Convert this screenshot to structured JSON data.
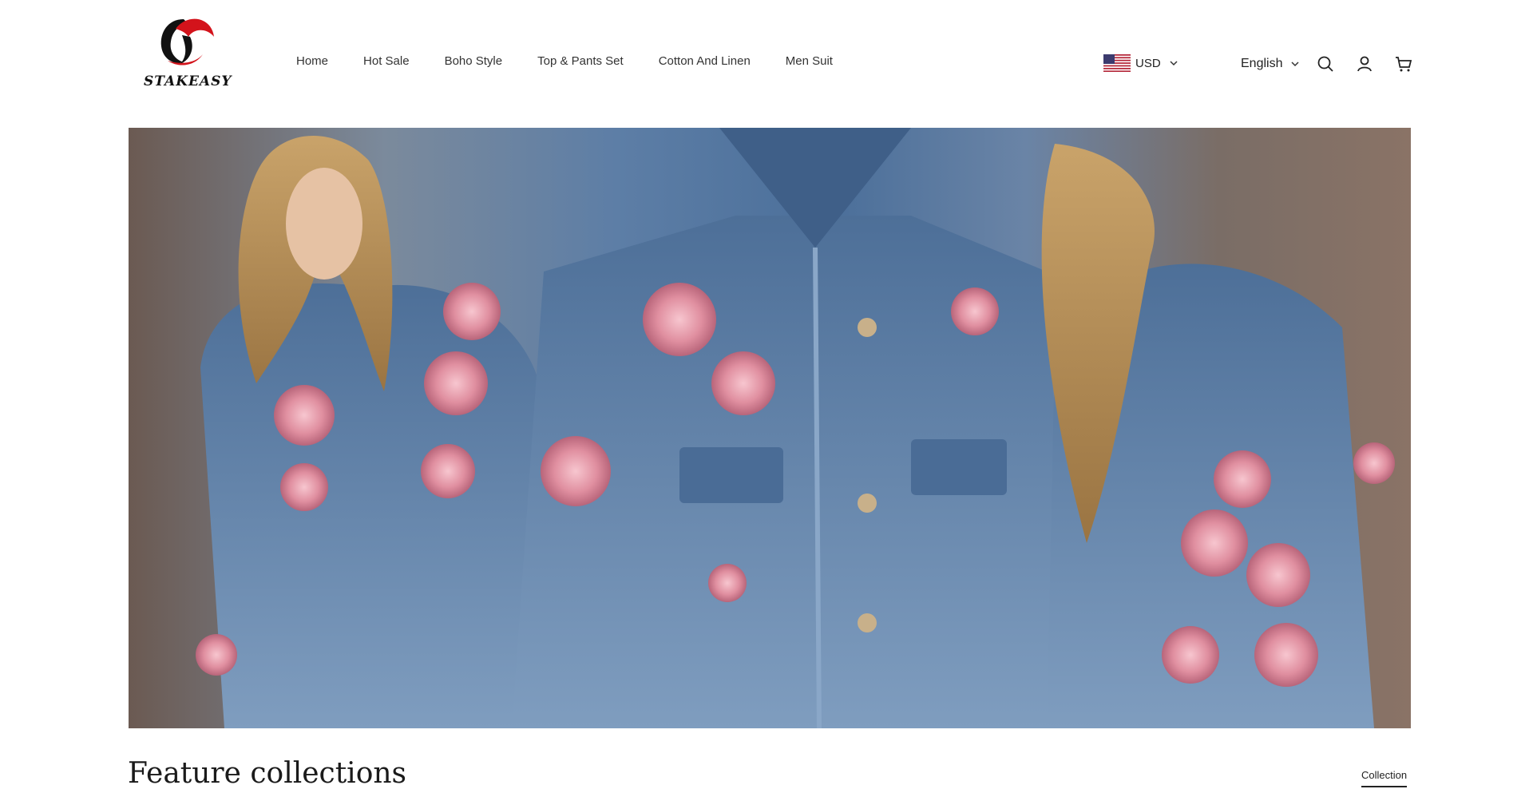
{
  "brand": {
    "name": "STAKEASY"
  },
  "nav": {
    "items": [
      {
        "label": "Home"
      },
      {
        "label": "Hot Sale"
      },
      {
        "label": "Boho Style"
      },
      {
        "label": "Top & Pants Set"
      },
      {
        "label": "Cotton And Linen"
      },
      {
        "label": "Men Suit"
      }
    ]
  },
  "header": {
    "currency": {
      "label": "USD",
      "flag_icon": "us-flag-icon"
    },
    "language": {
      "label": "English"
    },
    "icons": [
      "search-icon",
      "account-icon",
      "cart-icon"
    ]
  },
  "hero": {
    "image_alt": "Floral embroidered denim jackets"
  },
  "section": {
    "title": "Feature collections",
    "link_label": "Collection"
  },
  "colors": {
    "text": "#222222",
    "background": "#ffffff",
    "logo_red": "#d3131b"
  }
}
